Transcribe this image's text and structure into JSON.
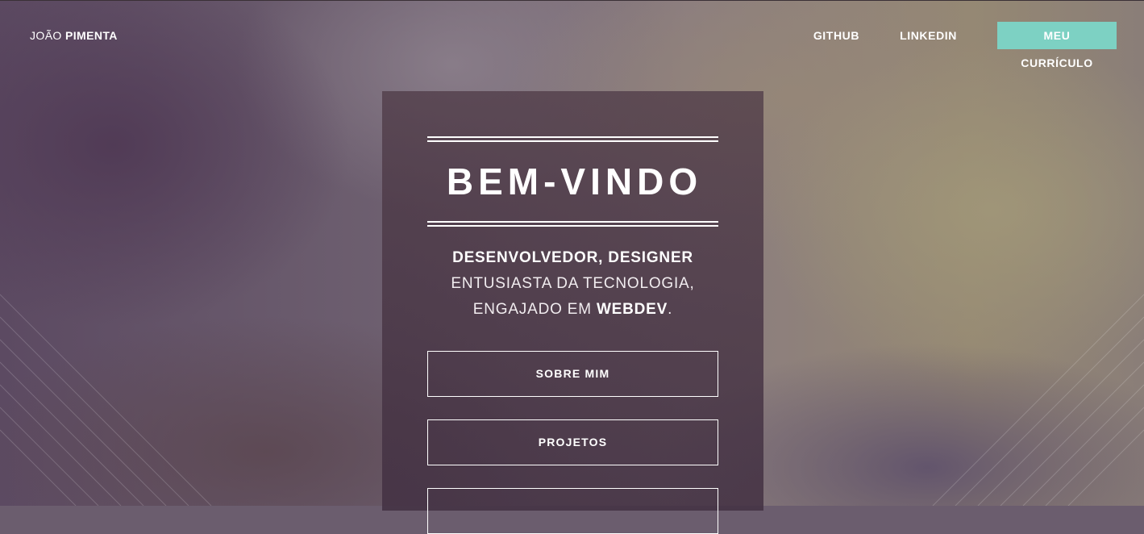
{
  "brand": {
    "first": "JOÃO",
    "last": "PIMENTA"
  },
  "nav": {
    "github": "GITHUB",
    "linkedin": "LINKEDIN",
    "resume": "MEU CURRÍCULO"
  },
  "hero": {
    "title": "BEM-VINDO",
    "line1": "DESENVOLVEDOR, DESIGNER",
    "line2": "ENTUSIASTA DA TECNOLOGIA,",
    "line3_prefix": "ENGAJADO EM ",
    "line3_highlight": "WEBDEV",
    "line3_suffix": "."
  },
  "buttons": {
    "about": "SOBRE MIM",
    "projects": "PROJETOS",
    "third": ""
  },
  "colors": {
    "accent": "#7dd1c3"
  }
}
